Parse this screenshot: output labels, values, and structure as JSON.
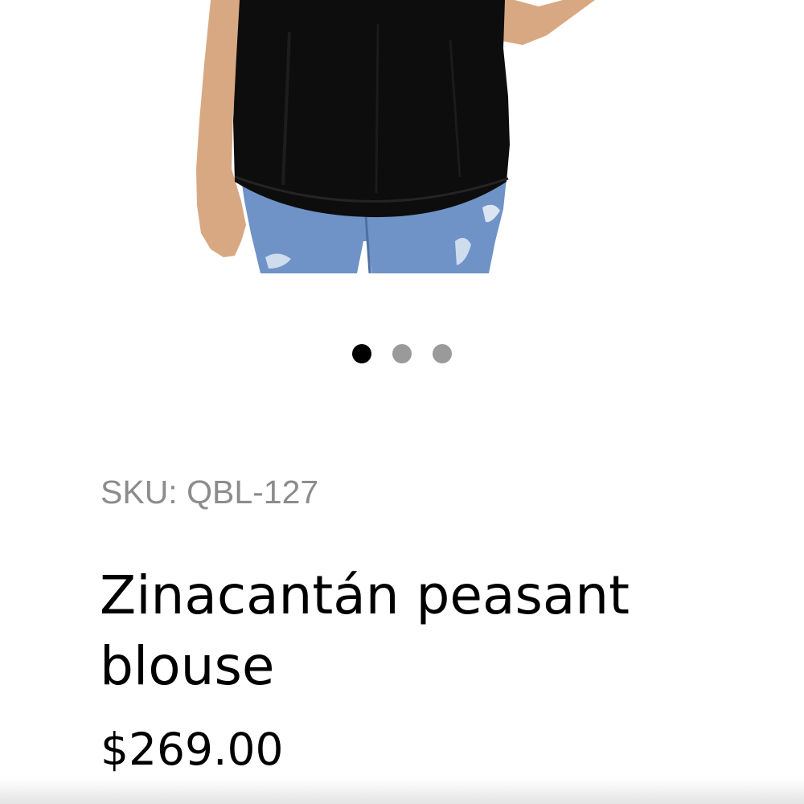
{
  "product": {
    "image_alt": "Model wearing black peasant blouse with blue jeans",
    "sku": "SKU: QBL-127",
    "title": "Zinacantán peasant blouse",
    "price": "$269.00"
  },
  "carousel": {
    "total_slides": 3,
    "active_index": 0
  },
  "colors": {
    "dot_active": "#000000",
    "dot_inactive": "#9a9a9a",
    "sku_text": "#8c8c8c"
  }
}
